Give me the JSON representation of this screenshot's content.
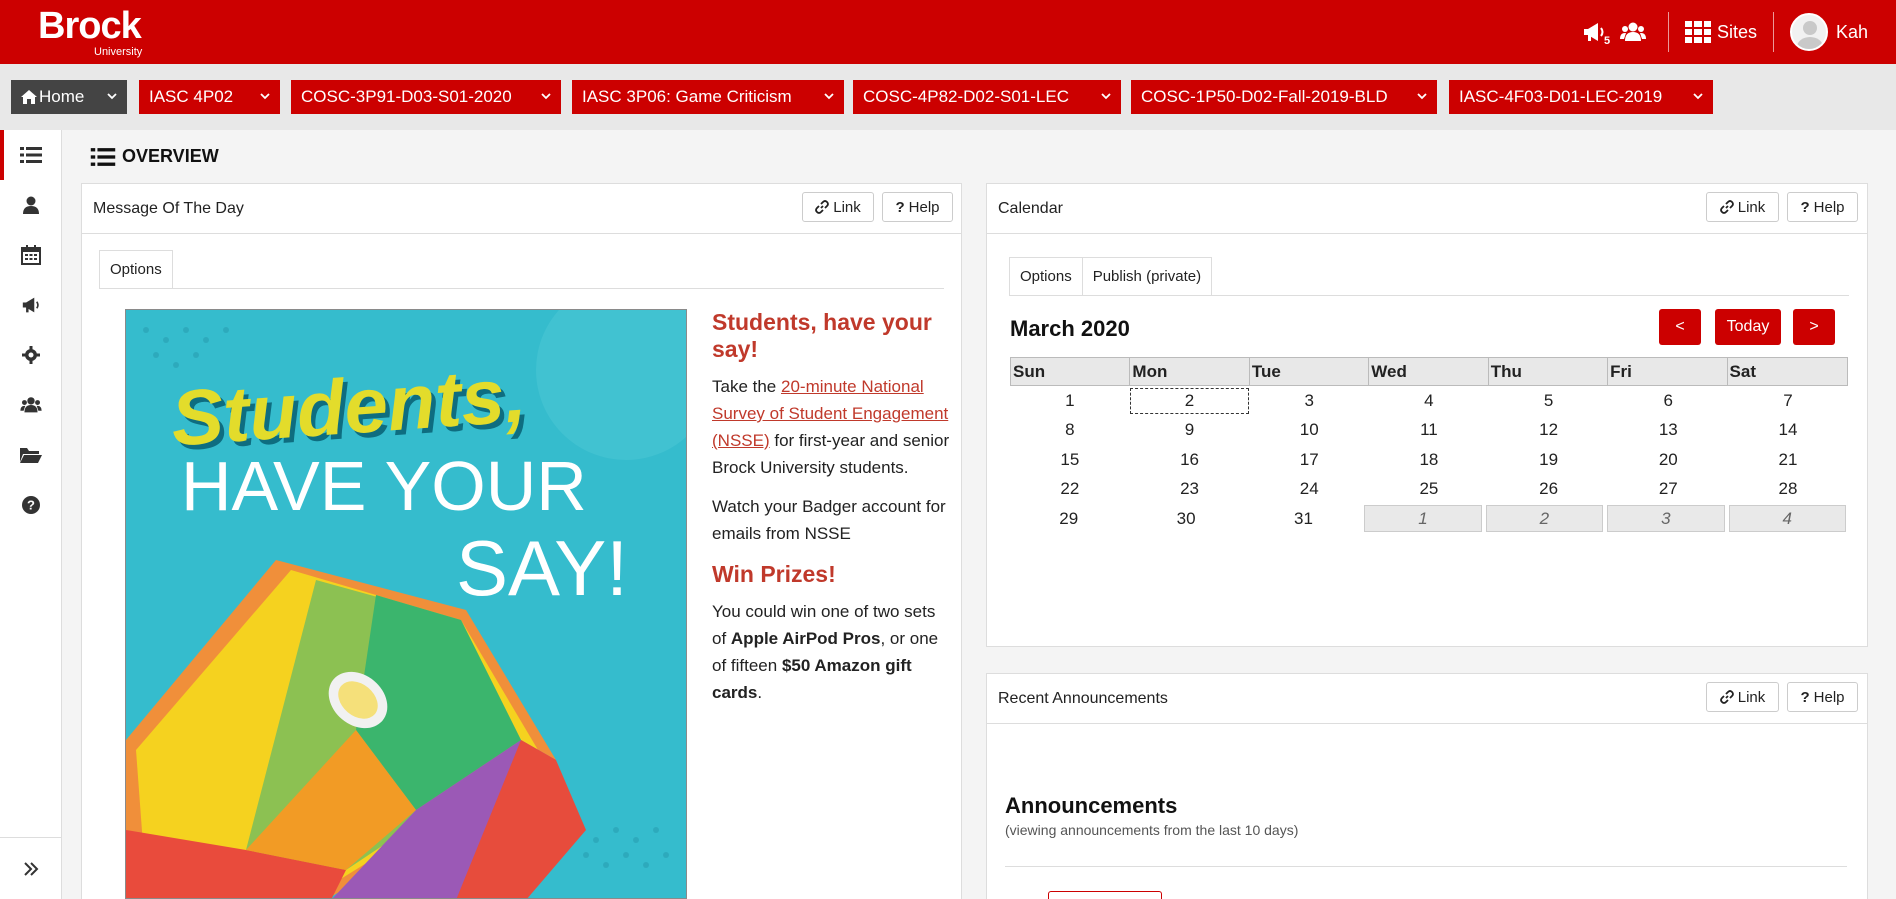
{
  "header": {
    "logo_text": "Brock",
    "logo_sub": "University",
    "notification_count": "5",
    "sites_label": "Sites",
    "user_name": "Kah",
    "brand_color": "#cc0000"
  },
  "site_nav": {
    "tabs": [
      {
        "label": "Home",
        "icon": "home-icon"
      },
      {
        "label": "IASC 4P02"
      },
      {
        "label": "COSC-3P91-D03-S01-2020"
      },
      {
        "label": "IASC 3P06: Game Criticism"
      },
      {
        "label": "COSC-4P82-D02-S01-LEC"
      },
      {
        "label": "COSC-1P50-D02-Fall-2019-BLD"
      },
      {
        "label": "IASC-4F03-D01-LEC-2019"
      }
    ]
  },
  "tool_menu": {
    "items": [
      "list-icon",
      "user-icon",
      "calendar-icon",
      "megaphone-icon",
      "gear-icon",
      "users-icon",
      "folder-open-icon",
      "question-circle-icon"
    ],
    "collapse_icon": "double-chevron-right-icon"
  },
  "page": {
    "title": "OVERVIEW"
  },
  "buttons": {
    "link": "Link",
    "help": "Help"
  },
  "motd": {
    "title": "Message Of The Day",
    "tab_options": "Options",
    "poster_line1": "Students,",
    "poster_line2": "HAVE YOUR",
    "poster_line3": "SAY!",
    "heading1": "Students, have your say!",
    "p1_pre": "Take the ",
    "p1_link": "20-minute National Survey of Student Engagement (NSSE)",
    "p1_post": " for first-year and senior Brock University students.",
    "p2": "Watch your Badger account for emails from NSSE",
    "heading2": "Win Prizes!",
    "p3_a": "You could win one of two sets of ",
    "p3_b": "Apple AirPod Pros",
    "p3_c": ", or one of fifteen ",
    "p3_d": "$50 Amazon gift cards",
    "p3_e": "."
  },
  "calendar": {
    "title": "Calendar",
    "tab_options": "Options",
    "tab_publish": "Publish (private)",
    "month": "March 2020",
    "prev_label": "<",
    "today_label": "Today",
    "next_label": ">",
    "weekdays": [
      "Sun",
      "Mon",
      "Tue",
      "Wed",
      "Thu",
      "Fri",
      "Sat"
    ],
    "weeks": [
      [
        "1",
        "2",
        "3",
        "4",
        "5",
        "6",
        "7"
      ],
      [
        "8",
        "9",
        "10",
        "11",
        "12",
        "13",
        "14"
      ],
      [
        "15",
        "16",
        "17",
        "18",
        "19",
        "20",
        "21"
      ],
      [
        "22",
        "23",
        "24",
        "25",
        "26",
        "27",
        "28"
      ],
      [
        "29",
        "30",
        "31",
        "1",
        "2",
        "3",
        "4"
      ]
    ],
    "today_day": "2"
  },
  "announcements": {
    "title": "Recent Announcements",
    "heading": "Announcements",
    "subtitle": "(viewing announcements from the last 10 days)"
  }
}
